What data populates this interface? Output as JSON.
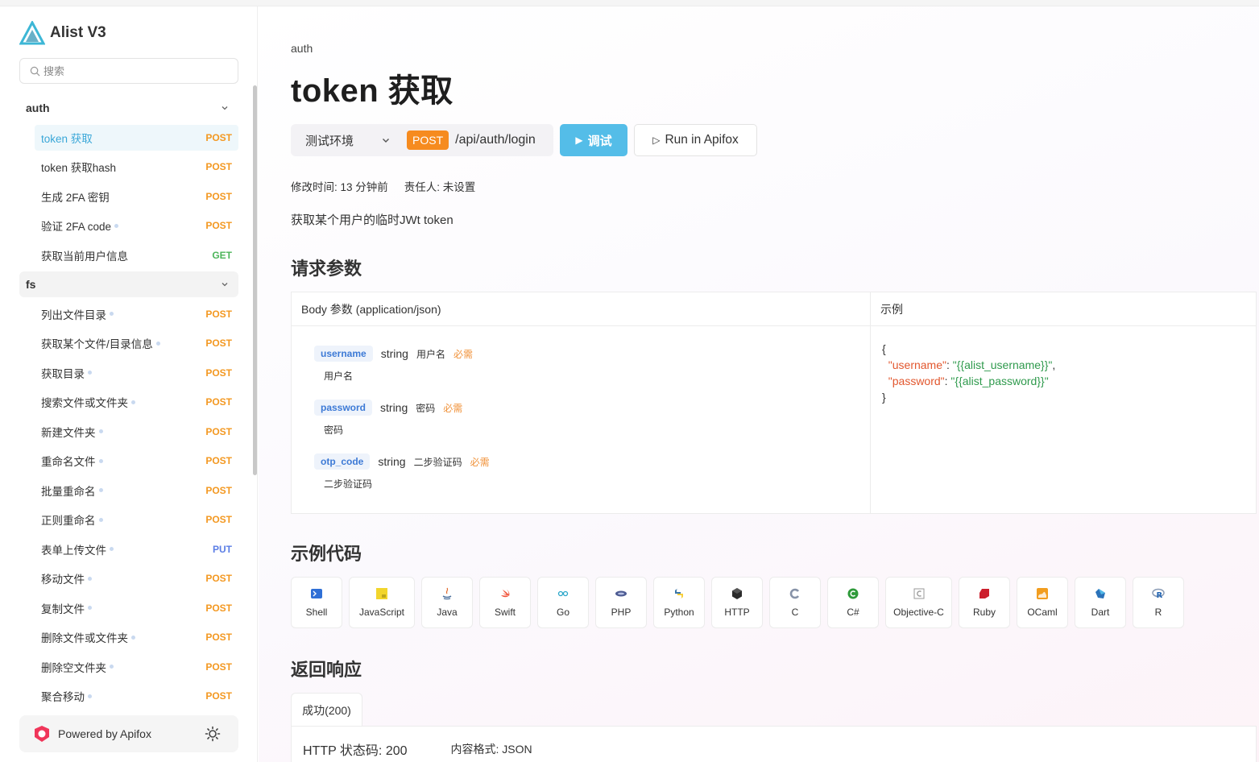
{
  "app": {
    "brand": "Alist V3"
  },
  "search": {
    "placeholder": "搜索"
  },
  "sidebar": {
    "groups": [
      {
        "name": "auth",
        "items": [
          {
            "label": "token 获取",
            "method": "POST",
            "active": true
          },
          {
            "label": "token 获取hash",
            "method": "POST"
          },
          {
            "label": "生成 2FA 密钥",
            "method": "POST"
          },
          {
            "label": "验证 2FA code",
            "method": "POST",
            "dot": true
          },
          {
            "label": "获取当前用户信息",
            "method": "GET"
          }
        ]
      },
      {
        "name": "fs",
        "items": [
          {
            "label": "列出文件目录",
            "method": "POST",
            "dot": true
          },
          {
            "label": "获取某个文件/目录信息",
            "method": "POST",
            "dot": true
          },
          {
            "label": "获取目录",
            "method": "POST",
            "dot": true
          },
          {
            "label": "搜索文件或文件夹",
            "method": "POST",
            "dot": true
          },
          {
            "label": "新建文件夹",
            "method": "POST",
            "dot": true
          },
          {
            "label": "重命名文件",
            "method": "POST",
            "dot": true
          },
          {
            "label": "批量重命名",
            "method": "POST",
            "dot": true
          },
          {
            "label": "正则重命名",
            "method": "POST",
            "dot": true
          },
          {
            "label": "表单上传文件",
            "method": "PUT",
            "dot": true
          },
          {
            "label": "移动文件",
            "method": "POST",
            "dot": true
          },
          {
            "label": "复制文件",
            "method": "POST",
            "dot": true
          },
          {
            "label": "删除文件或文件夹",
            "method": "POST",
            "dot": true
          },
          {
            "label": "删除空文件夹",
            "method": "POST",
            "dot": true
          },
          {
            "label": "聚合移动",
            "method": "POST",
            "dot": true
          }
        ]
      }
    ],
    "powered_by": "Powered by Apifox"
  },
  "page": {
    "breadcrumb": "auth",
    "title": "token 获取",
    "environment": "测试环境",
    "method": "POST",
    "path": "/api/auth/login",
    "try_label": "调试",
    "run_label": "Run in Apifox",
    "modified": "修改时间: 13 分钟前",
    "owner": "责任人: 未设置",
    "description": "获取某个用户的临时JWt token"
  },
  "request": {
    "heading": "请求参数",
    "body_header": "Body 参数 (application/json)",
    "example_header": "示例",
    "params": [
      {
        "name": "username",
        "type": "string",
        "title": "用户名",
        "required": "必需",
        "desc": "用户名"
      },
      {
        "name": "password",
        "type": "string",
        "title": "密码",
        "required": "必需",
        "desc": "密码"
      },
      {
        "name": "otp_code",
        "type": "string",
        "title": "二步验证码",
        "required": "必需",
        "desc": "二步验证码"
      }
    ],
    "example": {
      "open": "{",
      "k1": "\"username\"",
      "v1": "\"{{alist_username}}\"",
      "k2": "\"password\"",
      "v2": "\"{{alist_password}}\"",
      "close": "}"
    }
  },
  "code_samples": {
    "heading": "示例代码",
    "languages": [
      {
        "name": "Shell",
        "icon": "shell-icon"
      },
      {
        "name": "JavaScript",
        "icon": "javascript-icon"
      },
      {
        "name": "Java",
        "icon": "java-icon"
      },
      {
        "name": "Swift",
        "icon": "swift-icon"
      },
      {
        "name": "Go",
        "icon": "go-icon"
      },
      {
        "name": "PHP",
        "icon": "php-icon"
      },
      {
        "name": "Python",
        "icon": "python-icon"
      },
      {
        "name": "HTTP",
        "icon": "http-icon"
      },
      {
        "name": "C",
        "icon": "c-icon"
      },
      {
        "name": "C#",
        "icon": "csharp-icon"
      },
      {
        "name": "Objective-C",
        "icon": "objective-c-icon"
      },
      {
        "name": "Ruby",
        "icon": "ruby-icon"
      },
      {
        "name": "OCaml",
        "icon": "ocaml-icon"
      },
      {
        "name": "Dart",
        "icon": "dart-icon"
      },
      {
        "name": "R",
        "icon": "r-icon"
      }
    ]
  },
  "response": {
    "heading": "返回响应",
    "tab": "成功(200)",
    "status": "HTTP 状态码: 200",
    "content_type": "内容格式: JSON"
  },
  "colors": {
    "accent": "#54bde8",
    "post": "#f39821",
    "get": "#4cb55a",
    "put": "#5b7ee5"
  }
}
